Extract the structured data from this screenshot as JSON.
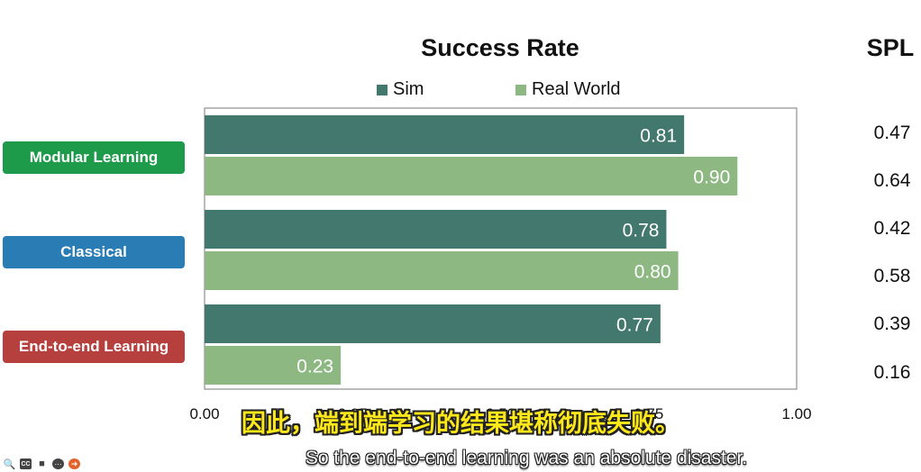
{
  "chart_data": {
    "type": "bar",
    "orientation": "horizontal",
    "title": "Success Rate",
    "categories": [
      "Modular Learning",
      "Classical",
      "End-to-end Learning"
    ],
    "category_colors": [
      "#1e9a4b",
      "#2a7db4",
      "#b5403d"
    ],
    "series": [
      {
        "name": "Sim",
        "values": [
          0.81,
          0.78,
          0.77
        ],
        "labels": [
          "0.81",
          "0.78",
          "0.77"
        ],
        "color": "#42786d"
      },
      {
        "name": "Real World",
        "values": [
          0.9,
          0.8,
          0.23
        ],
        "labels": [
          "0.90",
          "0.80",
          "0.23"
        ],
        "color": "#8db882"
      }
    ],
    "xlim": [
      0,
      1
    ],
    "xticks": [
      "0.00",
      "0.25",
      "0.50",
      "0.75",
      "1.00"
    ],
    "legend_position": "top-center",
    "grid": false
  },
  "spl": {
    "title": "SPL",
    "values": [
      "0.47",
      "0.64",
      "0.42",
      "0.58",
      "0.39",
      "0.16"
    ]
  },
  "subtitles": {
    "chinese": "因此，端到端学习的结果堪称彻底失败。",
    "english": "So the end-to-end learning was an absolute disaster."
  },
  "toolbar": {
    "icons": [
      "search-icon",
      "captions-icon",
      "camera-icon",
      "more-icon",
      "next-icon"
    ],
    "captions_text": "CC"
  }
}
